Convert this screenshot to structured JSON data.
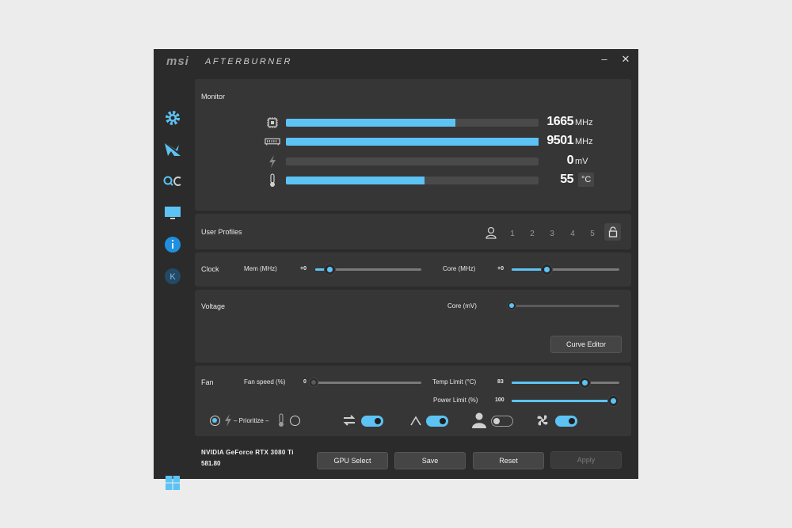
{
  "app": {
    "logo": "msi",
    "title": "AFTERBURNER",
    "minimize": "–",
    "close": "✕"
  },
  "sidebar": {
    "items": [
      {
        "icon": "settings-gear-icon"
      },
      {
        "icon": "dragon-icon"
      },
      {
        "icon": "oc-scanner-icon"
      },
      {
        "icon": "monitor-icon"
      },
      {
        "icon": "info-icon"
      },
      {
        "icon": "k-icon",
        "label": "K"
      }
    ],
    "windows_icon": "windows-icon"
  },
  "monitor": {
    "title": "Monitor",
    "rows": [
      {
        "icon": "gpu-chip-icon",
        "value": "1665",
        "unit": "MHz",
        "fraction": 0.67
      },
      {
        "icon": "memory-module-icon",
        "value": "9501",
        "unit": "MHz",
        "fraction": 1.0
      },
      {
        "icon": "lightning-icon",
        "value": "0",
        "unit": "mV",
        "fraction": 0.0
      },
      {
        "icon": "thermometer-icon",
        "value": "55",
        "unit": "°C",
        "fraction": 0.55
      }
    ]
  },
  "profiles": {
    "title": "User Profiles",
    "numbers": [
      "1",
      "2",
      "3",
      "4",
      "5"
    ]
  },
  "clock": {
    "title": "Clock",
    "mem_label": "Mem (MHz)",
    "mem_value": "+0",
    "mem_level": 0.14,
    "core_label": "Core (MHz)",
    "core_value": "+0",
    "core_level": 0.33
  },
  "voltage": {
    "title": "Voltage",
    "core_label": "Core (mV)",
    "core_level": 0.0,
    "curve_editor": "Curve Editor"
  },
  "fan": {
    "title": "Fan",
    "speed_label": "Fan speed (%)",
    "speed_value": "0",
    "speed_level": 0.0,
    "temp_label": "Temp Limit (°C)",
    "temp_value": "83",
    "temp_level": 0.68,
    "power_label": "Power Limit (%)",
    "power_value": "100",
    "power_level": 1.0,
    "prioritize_label": "– Prioritize –",
    "toggles": [
      {
        "icon": "sync-arrows-icon",
        "on": true
      },
      {
        "icon": "auto-a-icon",
        "on": true
      },
      {
        "icon": "user-icon",
        "on": false
      },
      {
        "icon": "fan-icon",
        "on": true
      }
    ]
  },
  "footer": {
    "gpu_name": "NVIDIA GeForce RTX 3080 Ti",
    "driver": "581.80",
    "gpu_select": "GPU Select",
    "save": "Save",
    "reset": "Reset",
    "apply": "Apply"
  },
  "colors": {
    "accent": "#5cc3f4",
    "window_bg": "#2b2b2b",
    "panel_bg": "#363636"
  }
}
